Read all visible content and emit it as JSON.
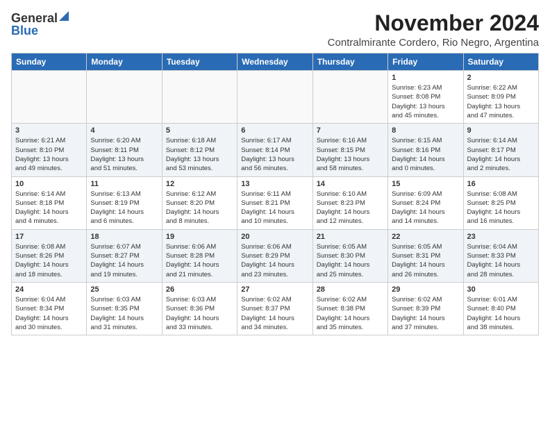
{
  "logo": {
    "general": "General",
    "blue": "Blue"
  },
  "title": "November 2024",
  "subtitle": "Contralmirante Cordero, Rio Negro, Argentina",
  "weekdays": [
    "Sunday",
    "Monday",
    "Tuesday",
    "Wednesday",
    "Thursday",
    "Friday",
    "Saturday"
  ],
  "weeks": [
    [
      {
        "day": "",
        "info": ""
      },
      {
        "day": "",
        "info": ""
      },
      {
        "day": "",
        "info": ""
      },
      {
        "day": "",
        "info": ""
      },
      {
        "day": "",
        "info": ""
      },
      {
        "day": "1",
        "info": "Sunrise: 6:23 AM\nSunset: 8:08 PM\nDaylight: 13 hours\nand 45 minutes."
      },
      {
        "day": "2",
        "info": "Sunrise: 6:22 AM\nSunset: 8:09 PM\nDaylight: 13 hours\nand 47 minutes."
      }
    ],
    [
      {
        "day": "3",
        "info": "Sunrise: 6:21 AM\nSunset: 8:10 PM\nDaylight: 13 hours\nand 49 minutes."
      },
      {
        "day": "4",
        "info": "Sunrise: 6:20 AM\nSunset: 8:11 PM\nDaylight: 13 hours\nand 51 minutes."
      },
      {
        "day": "5",
        "info": "Sunrise: 6:18 AM\nSunset: 8:12 PM\nDaylight: 13 hours\nand 53 minutes."
      },
      {
        "day": "6",
        "info": "Sunrise: 6:17 AM\nSunset: 8:14 PM\nDaylight: 13 hours\nand 56 minutes."
      },
      {
        "day": "7",
        "info": "Sunrise: 6:16 AM\nSunset: 8:15 PM\nDaylight: 13 hours\nand 58 minutes."
      },
      {
        "day": "8",
        "info": "Sunrise: 6:15 AM\nSunset: 8:16 PM\nDaylight: 14 hours\nand 0 minutes."
      },
      {
        "day": "9",
        "info": "Sunrise: 6:14 AM\nSunset: 8:17 PM\nDaylight: 14 hours\nand 2 minutes."
      }
    ],
    [
      {
        "day": "10",
        "info": "Sunrise: 6:14 AM\nSunset: 8:18 PM\nDaylight: 14 hours\nand 4 minutes."
      },
      {
        "day": "11",
        "info": "Sunrise: 6:13 AM\nSunset: 8:19 PM\nDaylight: 14 hours\nand 6 minutes."
      },
      {
        "day": "12",
        "info": "Sunrise: 6:12 AM\nSunset: 8:20 PM\nDaylight: 14 hours\nand 8 minutes."
      },
      {
        "day": "13",
        "info": "Sunrise: 6:11 AM\nSunset: 8:21 PM\nDaylight: 14 hours\nand 10 minutes."
      },
      {
        "day": "14",
        "info": "Sunrise: 6:10 AM\nSunset: 8:23 PM\nDaylight: 14 hours\nand 12 minutes."
      },
      {
        "day": "15",
        "info": "Sunrise: 6:09 AM\nSunset: 8:24 PM\nDaylight: 14 hours\nand 14 minutes."
      },
      {
        "day": "16",
        "info": "Sunrise: 6:08 AM\nSunset: 8:25 PM\nDaylight: 14 hours\nand 16 minutes."
      }
    ],
    [
      {
        "day": "17",
        "info": "Sunrise: 6:08 AM\nSunset: 8:26 PM\nDaylight: 14 hours\nand 18 minutes."
      },
      {
        "day": "18",
        "info": "Sunrise: 6:07 AM\nSunset: 8:27 PM\nDaylight: 14 hours\nand 19 minutes."
      },
      {
        "day": "19",
        "info": "Sunrise: 6:06 AM\nSunset: 8:28 PM\nDaylight: 14 hours\nand 21 minutes."
      },
      {
        "day": "20",
        "info": "Sunrise: 6:06 AM\nSunset: 8:29 PM\nDaylight: 14 hours\nand 23 minutes."
      },
      {
        "day": "21",
        "info": "Sunrise: 6:05 AM\nSunset: 8:30 PM\nDaylight: 14 hours\nand 25 minutes."
      },
      {
        "day": "22",
        "info": "Sunrise: 6:05 AM\nSunset: 8:31 PM\nDaylight: 14 hours\nand 26 minutes."
      },
      {
        "day": "23",
        "info": "Sunrise: 6:04 AM\nSunset: 8:33 PM\nDaylight: 14 hours\nand 28 minutes."
      }
    ],
    [
      {
        "day": "24",
        "info": "Sunrise: 6:04 AM\nSunset: 8:34 PM\nDaylight: 14 hours\nand 30 minutes."
      },
      {
        "day": "25",
        "info": "Sunrise: 6:03 AM\nSunset: 8:35 PM\nDaylight: 14 hours\nand 31 minutes."
      },
      {
        "day": "26",
        "info": "Sunrise: 6:03 AM\nSunset: 8:36 PM\nDaylight: 14 hours\nand 33 minutes."
      },
      {
        "day": "27",
        "info": "Sunrise: 6:02 AM\nSunset: 8:37 PM\nDaylight: 14 hours\nand 34 minutes."
      },
      {
        "day": "28",
        "info": "Sunrise: 6:02 AM\nSunset: 8:38 PM\nDaylight: 14 hours\nand 35 minutes."
      },
      {
        "day": "29",
        "info": "Sunrise: 6:02 AM\nSunset: 8:39 PM\nDaylight: 14 hours\nand 37 minutes."
      },
      {
        "day": "30",
        "info": "Sunrise: 6:01 AM\nSunset: 8:40 PM\nDaylight: 14 hours\nand 38 minutes."
      }
    ]
  ]
}
